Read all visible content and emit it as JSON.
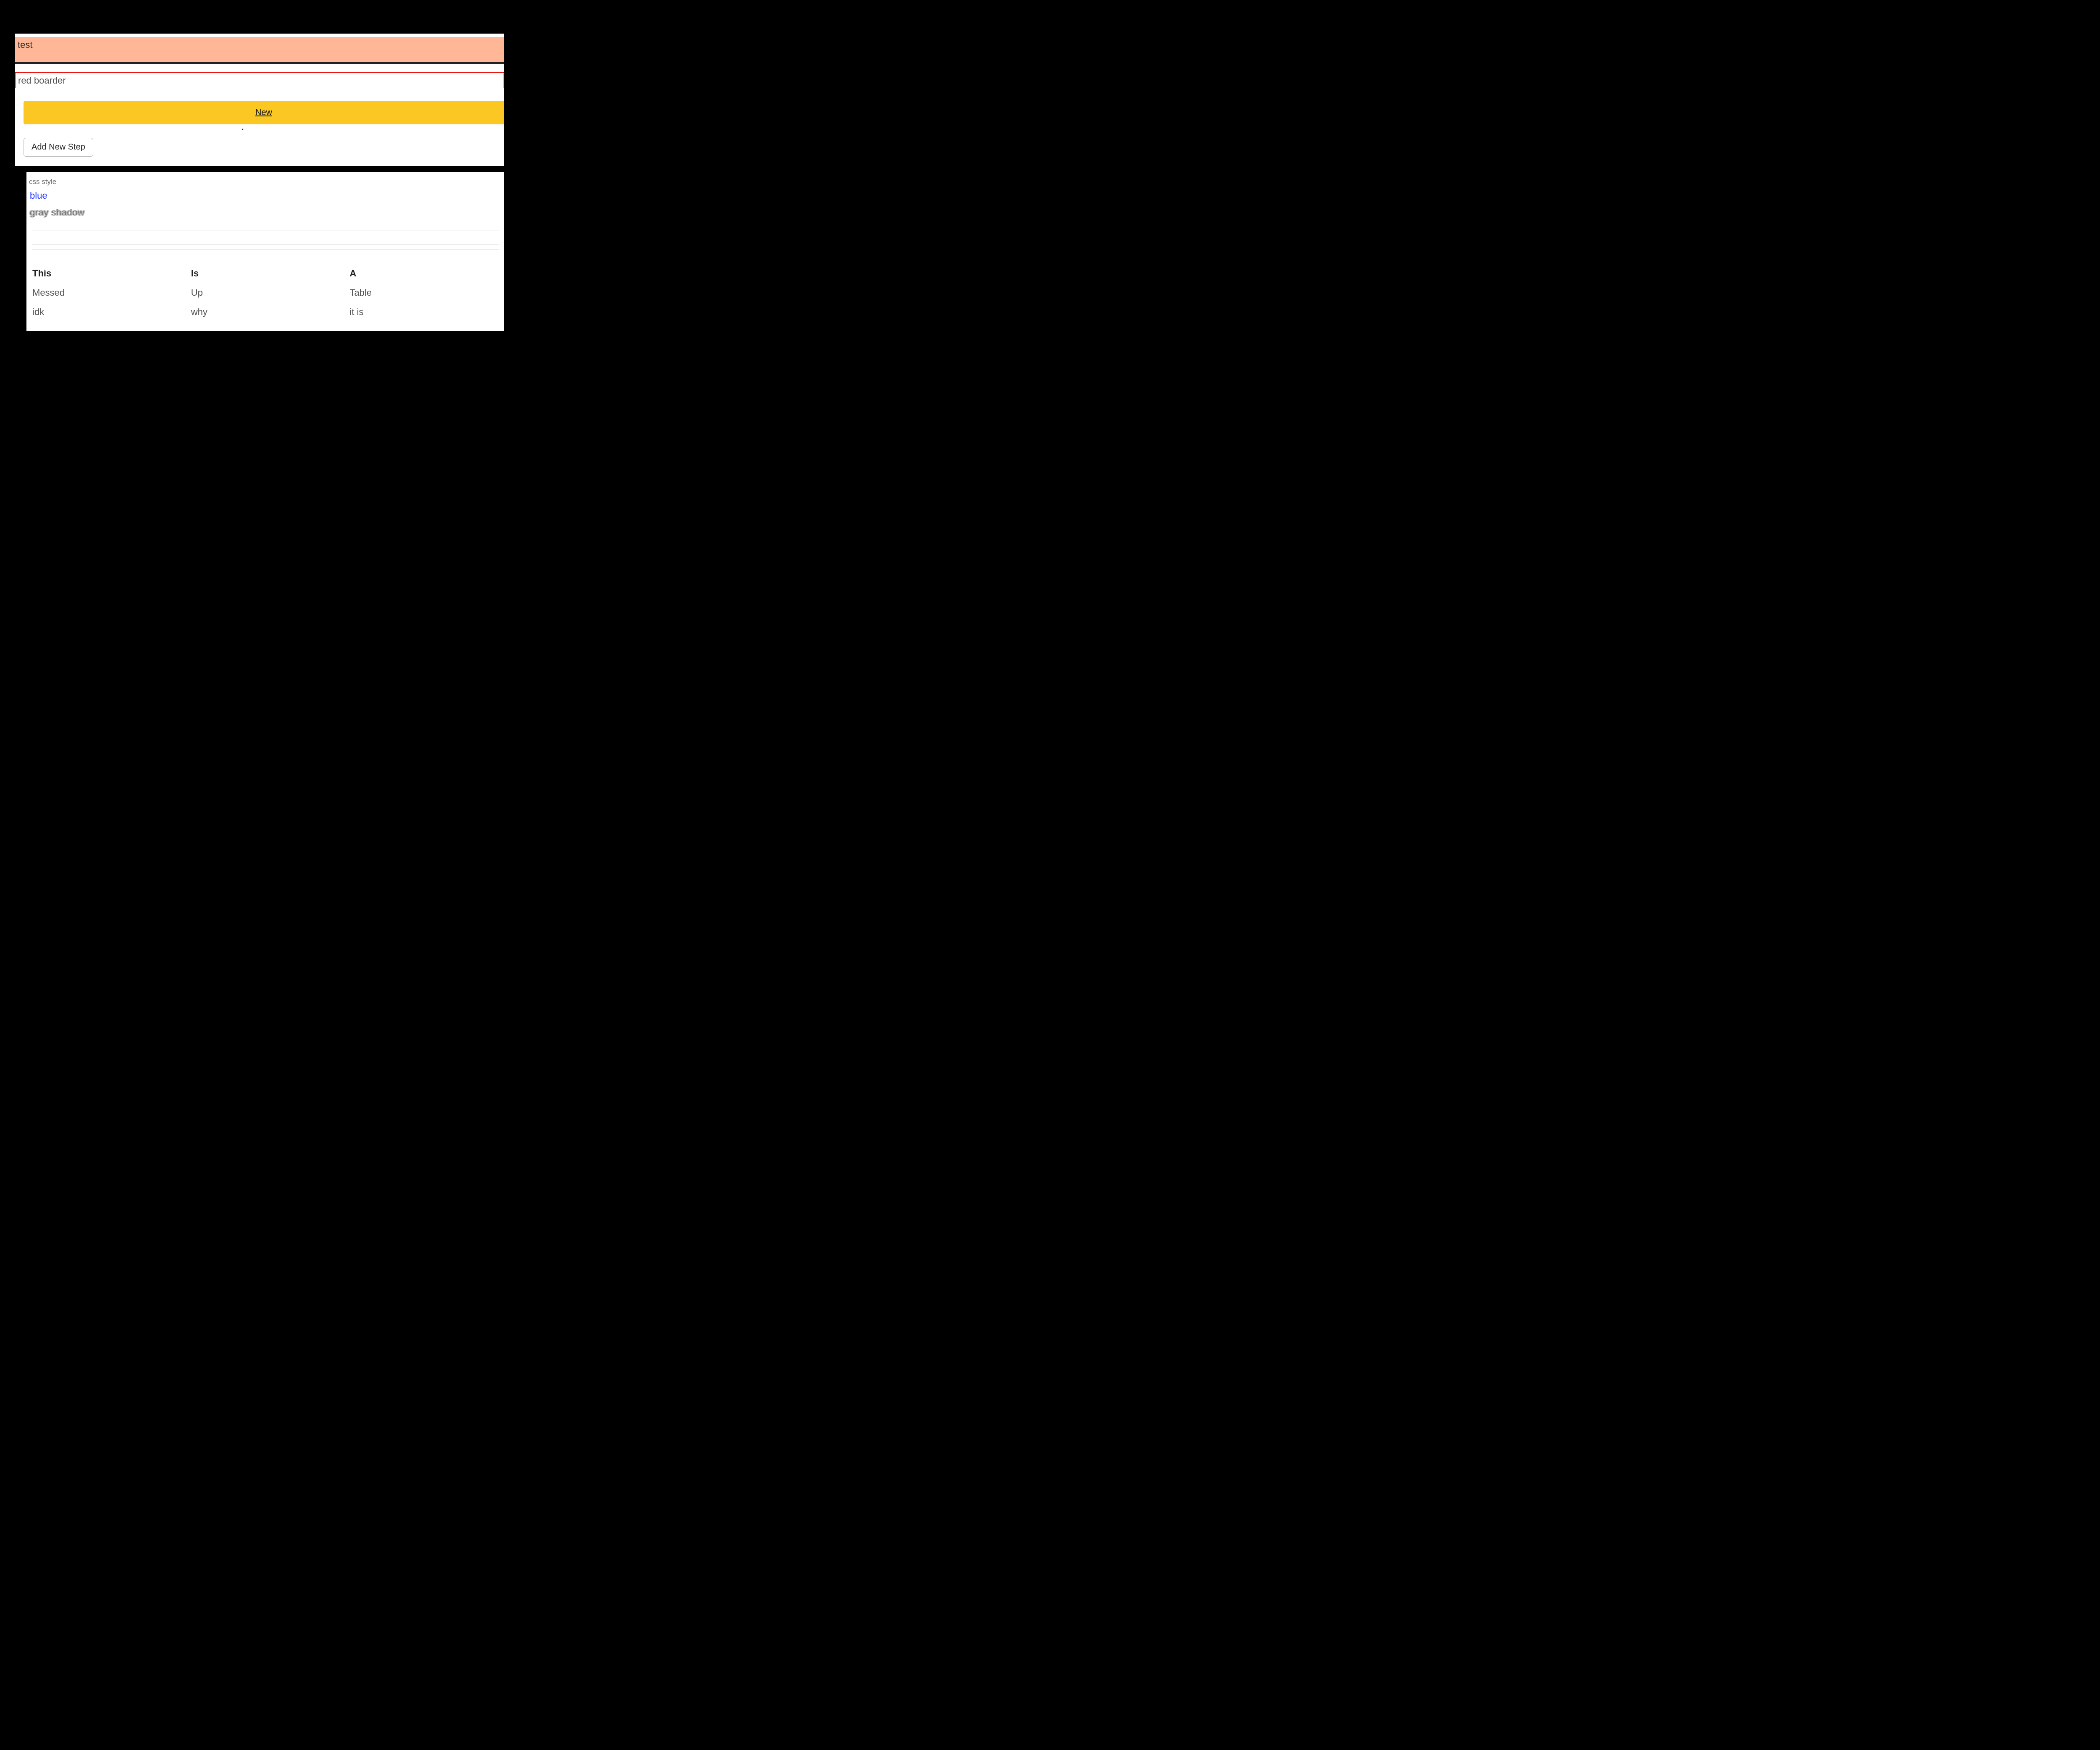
{
  "top": {
    "peach_text": "test",
    "red_border_text": "red boarder",
    "new_link_label": "New",
    "add_step_label": "Add New Step",
    "dot": "."
  },
  "bottom": {
    "css_style_label": "css style",
    "blue_text": "blue",
    "gray_shadow_text": "gray shadow",
    "table": {
      "headers": [
        "This",
        "Is",
        "A"
      ],
      "rows": [
        [
          "Messed",
          "Up",
          "Table"
        ],
        [
          "idk",
          "why",
          "it is"
        ]
      ]
    }
  }
}
